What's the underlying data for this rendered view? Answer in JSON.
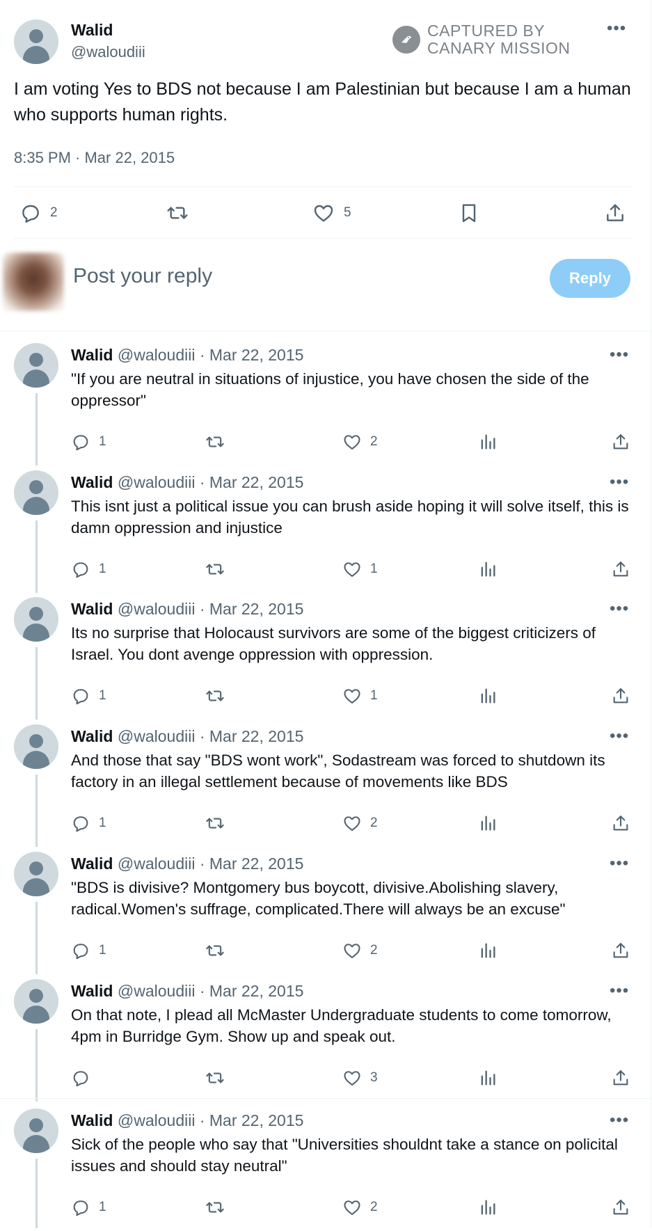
{
  "main_tweet": {
    "name": "Walid",
    "handle": "@waloudiii",
    "watermark_line1": "CAPTURED BY",
    "watermark_line2": "CANARY MISSION",
    "text": "I am voting Yes to BDS not because I am Palestinian but because I am a human who supports human rights.",
    "timestamp": "8:35 PM · Mar 22, 2015",
    "replies": "2",
    "likes": "5"
  },
  "composer": {
    "placeholder": "Post your reply",
    "reply_label": "Reply"
  },
  "thread": [
    {
      "name": "Walid",
      "meta": "@waloudiii · Mar 22, 2015",
      "text": "\"If you are neutral in situations of injustice, you have chosen the side of the oppressor\"",
      "replies": "1",
      "likes": "2"
    },
    {
      "name": "Walid",
      "meta": "@waloudiii · Mar 22, 2015",
      "text": "This isnt just a political issue you can brush aside hoping it will solve itself, this is damn  oppression and injustice",
      "replies": "1",
      "likes": "1"
    },
    {
      "name": "Walid",
      "meta": "@waloudiii · Mar 22, 2015",
      "text": "Its no surprise that Holocaust survivors are some of the biggest criticizers of Israel. You dont avenge oppression with oppression.",
      "replies": "1",
      "likes": "1"
    },
    {
      "name": "Walid",
      "meta": "@waloudiii · Mar 22, 2015",
      "text": "And those that say \"BDS wont work\", Sodastream was forced to shutdown its factory in an illegal settlement because of movements like BDS",
      "replies": "1",
      "likes": "2"
    },
    {
      "name": "Walid",
      "meta": "@waloudiii · Mar 22, 2015",
      "text": "\"BDS is divisive? Montgomery bus boycott, divisive.Abolishing slavery, radical.Women's suffrage, complicated.There will always be an excuse\"",
      "replies": "1",
      "likes": "2"
    },
    {
      "name": "Walid",
      "meta": "@waloudiii · Mar 22, 2015",
      "text": "On that note, I plead all McMaster Undergraduate students to come tomorrow, 4pm in Burridge Gym. Show up and speak out.",
      "replies": "",
      "likes": "3"
    },
    {
      "name": "Walid",
      "meta": "@waloudiii · Mar 22, 2015",
      "text": "Sick of the people who say that \"Universities shouldnt take a stance on policital issues and should stay neutral\"",
      "replies": "1",
      "likes": "2"
    }
  ],
  "icons": {
    "reply": "reply-icon",
    "retweet": "retweet-icon",
    "like": "heart-icon",
    "bookmark": "bookmark-icon",
    "share": "share-icon",
    "views": "views-icon",
    "more": "more-icon"
  },
  "colors": {
    "text": "#0f1419",
    "secondary": "#536471",
    "reply_button": "#8ecdf8",
    "divider": "#eff3f4"
  }
}
